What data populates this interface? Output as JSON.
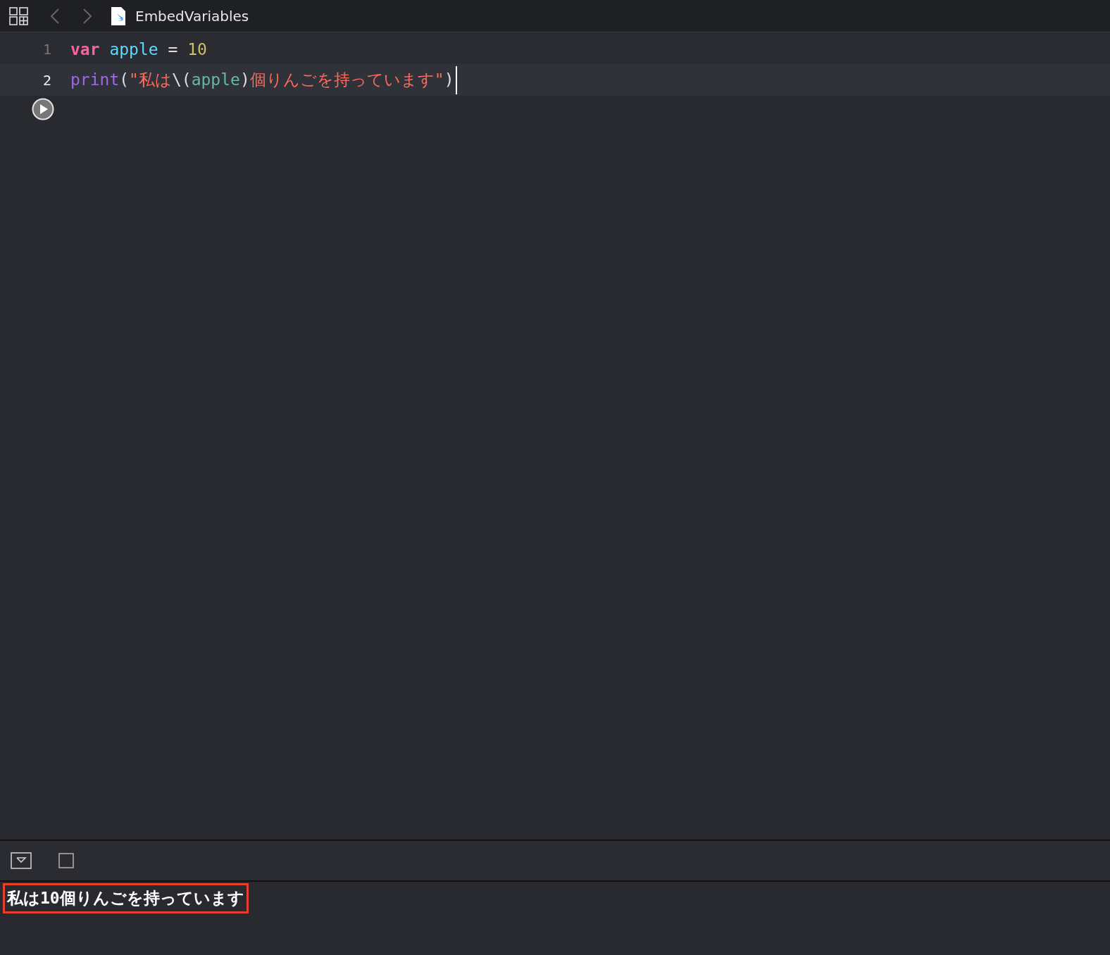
{
  "toolbar": {
    "file_name": "EmbedVariables"
  },
  "editor": {
    "lines": [
      {
        "number": "1",
        "current": false,
        "tokens": [
          {
            "kind": "keyword",
            "text": "var "
          },
          {
            "kind": "identifier",
            "text": "apple"
          },
          {
            "kind": "plain",
            "text": " = "
          },
          {
            "kind": "number",
            "text": "10"
          }
        ]
      },
      {
        "number": "2",
        "current": true,
        "tokens": [
          {
            "kind": "function",
            "text": "print"
          },
          {
            "kind": "plain",
            "text": "("
          },
          {
            "kind": "string",
            "text": "\"私は"
          },
          {
            "kind": "plain",
            "text": "\\("
          },
          {
            "kind": "interpolation",
            "text": "apple"
          },
          {
            "kind": "plain",
            "text": ")"
          },
          {
            "kind": "string",
            "text": "個りんごを持っています\""
          },
          {
            "kind": "plain",
            "text": ")"
          }
        ]
      }
    ]
  },
  "console": {
    "output": "私は10個りんごを持っています",
    "highlighted": true
  }
}
